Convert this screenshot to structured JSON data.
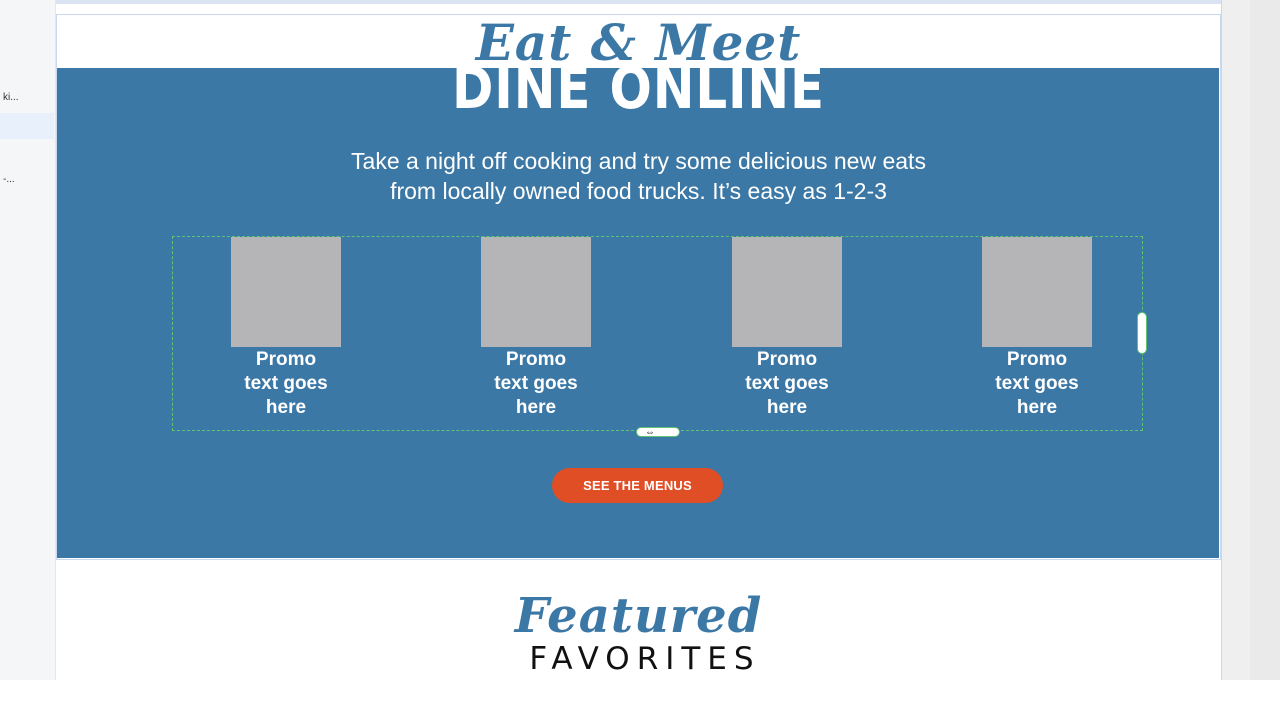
{
  "left_panel": {
    "items": [
      {
        "label": "ki..."
      },
      {
        "label": ""
      },
      {
        "label": "-..."
      }
    ]
  },
  "hero": {
    "script_title": "Eat & Meet",
    "headline": "DINE ONLINE",
    "intro_line1": "Take a night off cooking and try some delicious new eats",
    "intro_line2": "from locally owned food trucks. It’s easy as 1-2-3"
  },
  "promos": [
    {
      "line1": "Promo",
      "line2": "text goes",
      "line3": "here"
    },
    {
      "line1": "Promo",
      "line2": "text goes",
      "line3": "here"
    },
    {
      "line1": "Promo",
      "line2": "text goes",
      "line3": "here"
    },
    {
      "line1": "Promo",
      "line2": "text goes",
      "line3": "here"
    }
  ],
  "cta": {
    "label": "SEE THE MENUS"
  },
  "featured": {
    "script_title": "Featured",
    "subtitle": "FAVORITES"
  },
  "colors": {
    "section_blue": "#3c78a6",
    "cta_orange": "#e04e25",
    "placeholder_gray": "#b5b4b6",
    "selection_green": "#5fc46f"
  }
}
